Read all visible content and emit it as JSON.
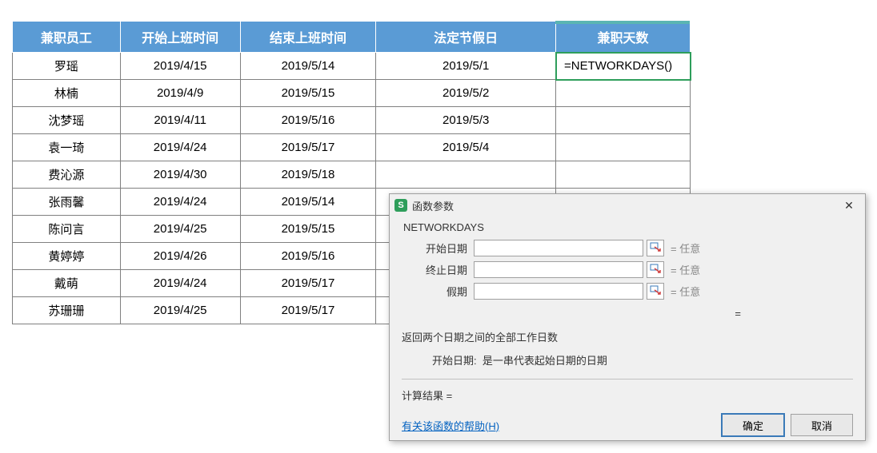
{
  "table": {
    "headers": [
      "兼职员工",
      "开始上班时间",
      "结束上班时间",
      "法定节假日",
      "兼职天数"
    ],
    "rows": [
      {
        "emp": "罗瑶",
        "start": "2019/4/15",
        "end": "2019/5/14",
        "holiday": "2019/5/1",
        "days": "=NETWORKDAYS()"
      },
      {
        "emp": "林楠",
        "start": "2019/4/9",
        "end": "2019/5/15",
        "holiday": "2019/5/2",
        "days": ""
      },
      {
        "emp": "沈梦瑶",
        "start": "2019/4/11",
        "end": "2019/5/16",
        "holiday": "2019/5/3",
        "days": ""
      },
      {
        "emp": "袁一琦",
        "start": "2019/4/24",
        "end": "2019/5/17",
        "holiday": "2019/5/4",
        "days": ""
      },
      {
        "emp": "费沁源",
        "start": "2019/4/30",
        "end": "2019/5/18",
        "holiday": "",
        "days": ""
      },
      {
        "emp": "张雨馨",
        "start": "2019/4/24",
        "end": "2019/5/14",
        "holiday": "",
        "days": ""
      },
      {
        "emp": "陈问言",
        "start": "2019/4/25",
        "end": "2019/5/15",
        "holiday": "",
        "days": ""
      },
      {
        "emp": "黄婷婷",
        "start": "2019/4/26",
        "end": "2019/5/16",
        "holiday": "",
        "days": ""
      },
      {
        "emp": "戴萌",
        "start": "2019/4/24",
        "end": "2019/5/17",
        "holiday": "",
        "days": ""
      },
      {
        "emp": "苏珊珊",
        "start": "2019/4/25",
        "end": "2019/5/17",
        "holiday": "",
        "days": ""
      }
    ]
  },
  "dialog": {
    "title": "函数参数",
    "function_name": "NETWORKDAYS",
    "params": [
      {
        "label": "开始日期",
        "value": "",
        "result": "= 任意"
      },
      {
        "label": "终止日期",
        "value": "",
        "result": "= 任意"
      },
      {
        "label": "假期",
        "value": "",
        "result": "= 任意"
      }
    ],
    "equals_line": "=",
    "description": "返回两个日期之间的全部工作日数",
    "param_desc_label": "开始日期:",
    "param_desc_text": "是一串代表起始日期的日期",
    "result_label": "计算结果 =",
    "result_value": "",
    "help_link": "有关该函数的帮助(H)",
    "ok_label": "确定",
    "cancel_label": "取消",
    "app_icon_letter": "S"
  }
}
